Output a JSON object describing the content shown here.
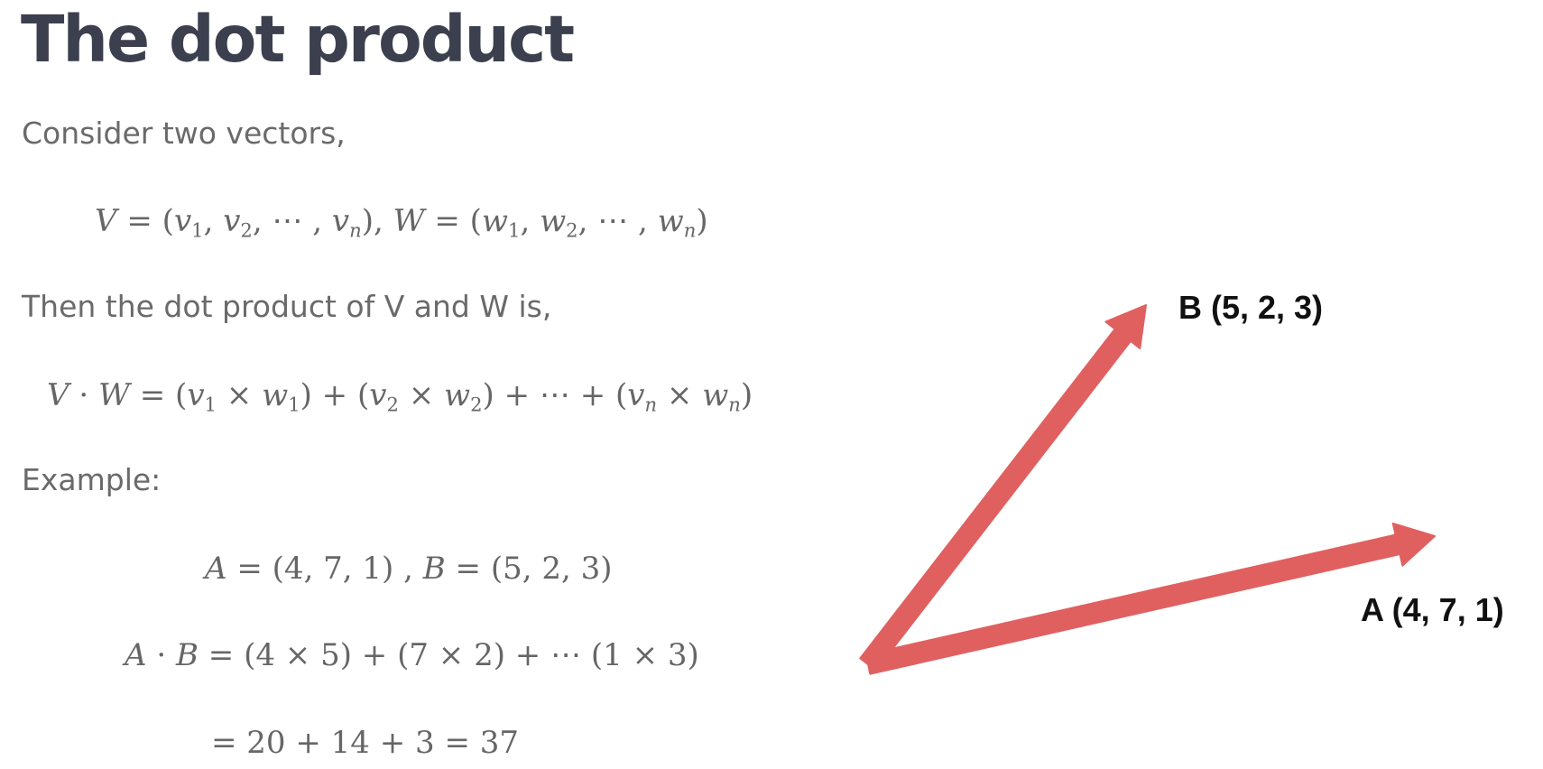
{
  "title": "The dot product",
  "intro_text": "Consider two vectors,",
  "dot_intro_text": "Then the dot product of V and W is,",
  "example_label": "Example:",
  "figure": {
    "vector_b_label": "B (5, 2, 3)",
    "vector_a_label": "A (4, 7, 1)",
    "arrow_color": "#e06060"
  }
}
